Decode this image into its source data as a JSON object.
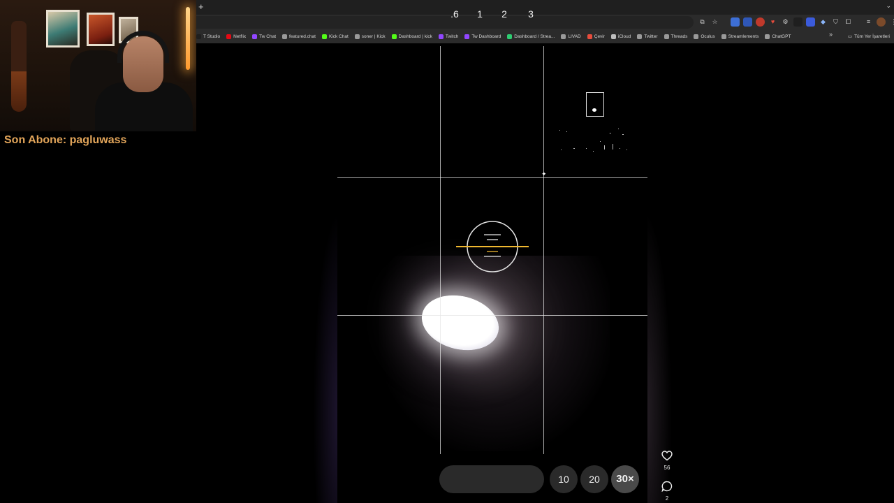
{
  "overlay": {
    "subscriber_text": "Son Abone: pagluwass"
  },
  "browser": {
    "new_tab_glyph": "+",
    "tab_menu_glyph": "⌄",
    "bookmarks": [
      {
        "label": "T Studio",
        "icon": "studio-icon",
        "color": "#1f1f1f"
      },
      {
        "label": "Netflix",
        "icon": "netflix-icon",
        "color": "#e50914"
      },
      {
        "label": "Tw Chat",
        "icon": "twitch-icon",
        "color": "#9146ff"
      },
      {
        "label": "featured.chat",
        "icon": "globe-icon",
        "color": "#9a9a9a"
      },
      {
        "label": "Kick Chat",
        "icon": "kick-icon",
        "color": "#53fc18"
      },
      {
        "label": "soner | Kick",
        "icon": "globe-icon",
        "color": "#9a9a9a"
      },
      {
        "label": "Dashboard | kick",
        "icon": "kick-icon",
        "color": "#53fc18"
      },
      {
        "label": "Twitch",
        "icon": "twitch-icon",
        "color": "#9146ff"
      },
      {
        "label": "Tw Dashboard",
        "icon": "twitch-icon",
        "color": "#9146ff"
      },
      {
        "label": "Dashboard / Strea...",
        "icon": "dashboard-icon",
        "color": "#2ecc71"
      },
      {
        "label": "LIVAD",
        "icon": "globe-icon",
        "color": "#9a9a9a"
      },
      {
        "label": "Çevir",
        "icon": "translate-icon",
        "color": "#e74c3c"
      },
      {
        "label": "iCloud",
        "icon": "apple-icon",
        "color": "#bdbdbd"
      },
      {
        "label": "Twitter",
        "icon": "globe-icon",
        "color": "#9a9a9a"
      },
      {
        "label": "Threads",
        "icon": "globe-icon",
        "color": "#9a9a9a"
      },
      {
        "label": "Oculus",
        "icon": "globe-icon",
        "color": "#9a9a9a"
      },
      {
        "label": "Streamlements",
        "icon": "globe-icon",
        "color": "#9a9a9a"
      },
      {
        "label": "ChatGPT",
        "icon": "globe-icon",
        "color": "#9a9a9a"
      }
    ],
    "more_glyph": "»",
    "other_bookmarks_label": "Tüm Yer İşaretleri"
  },
  "camera": {
    "zoom_levels": [
      ".6",
      "1",
      "2",
      "3",
      "10",
      "20",
      "30×"
    ],
    "active_zoom": "30×"
  },
  "side_actions": {
    "likes_count": "56",
    "comments_count": "2"
  }
}
